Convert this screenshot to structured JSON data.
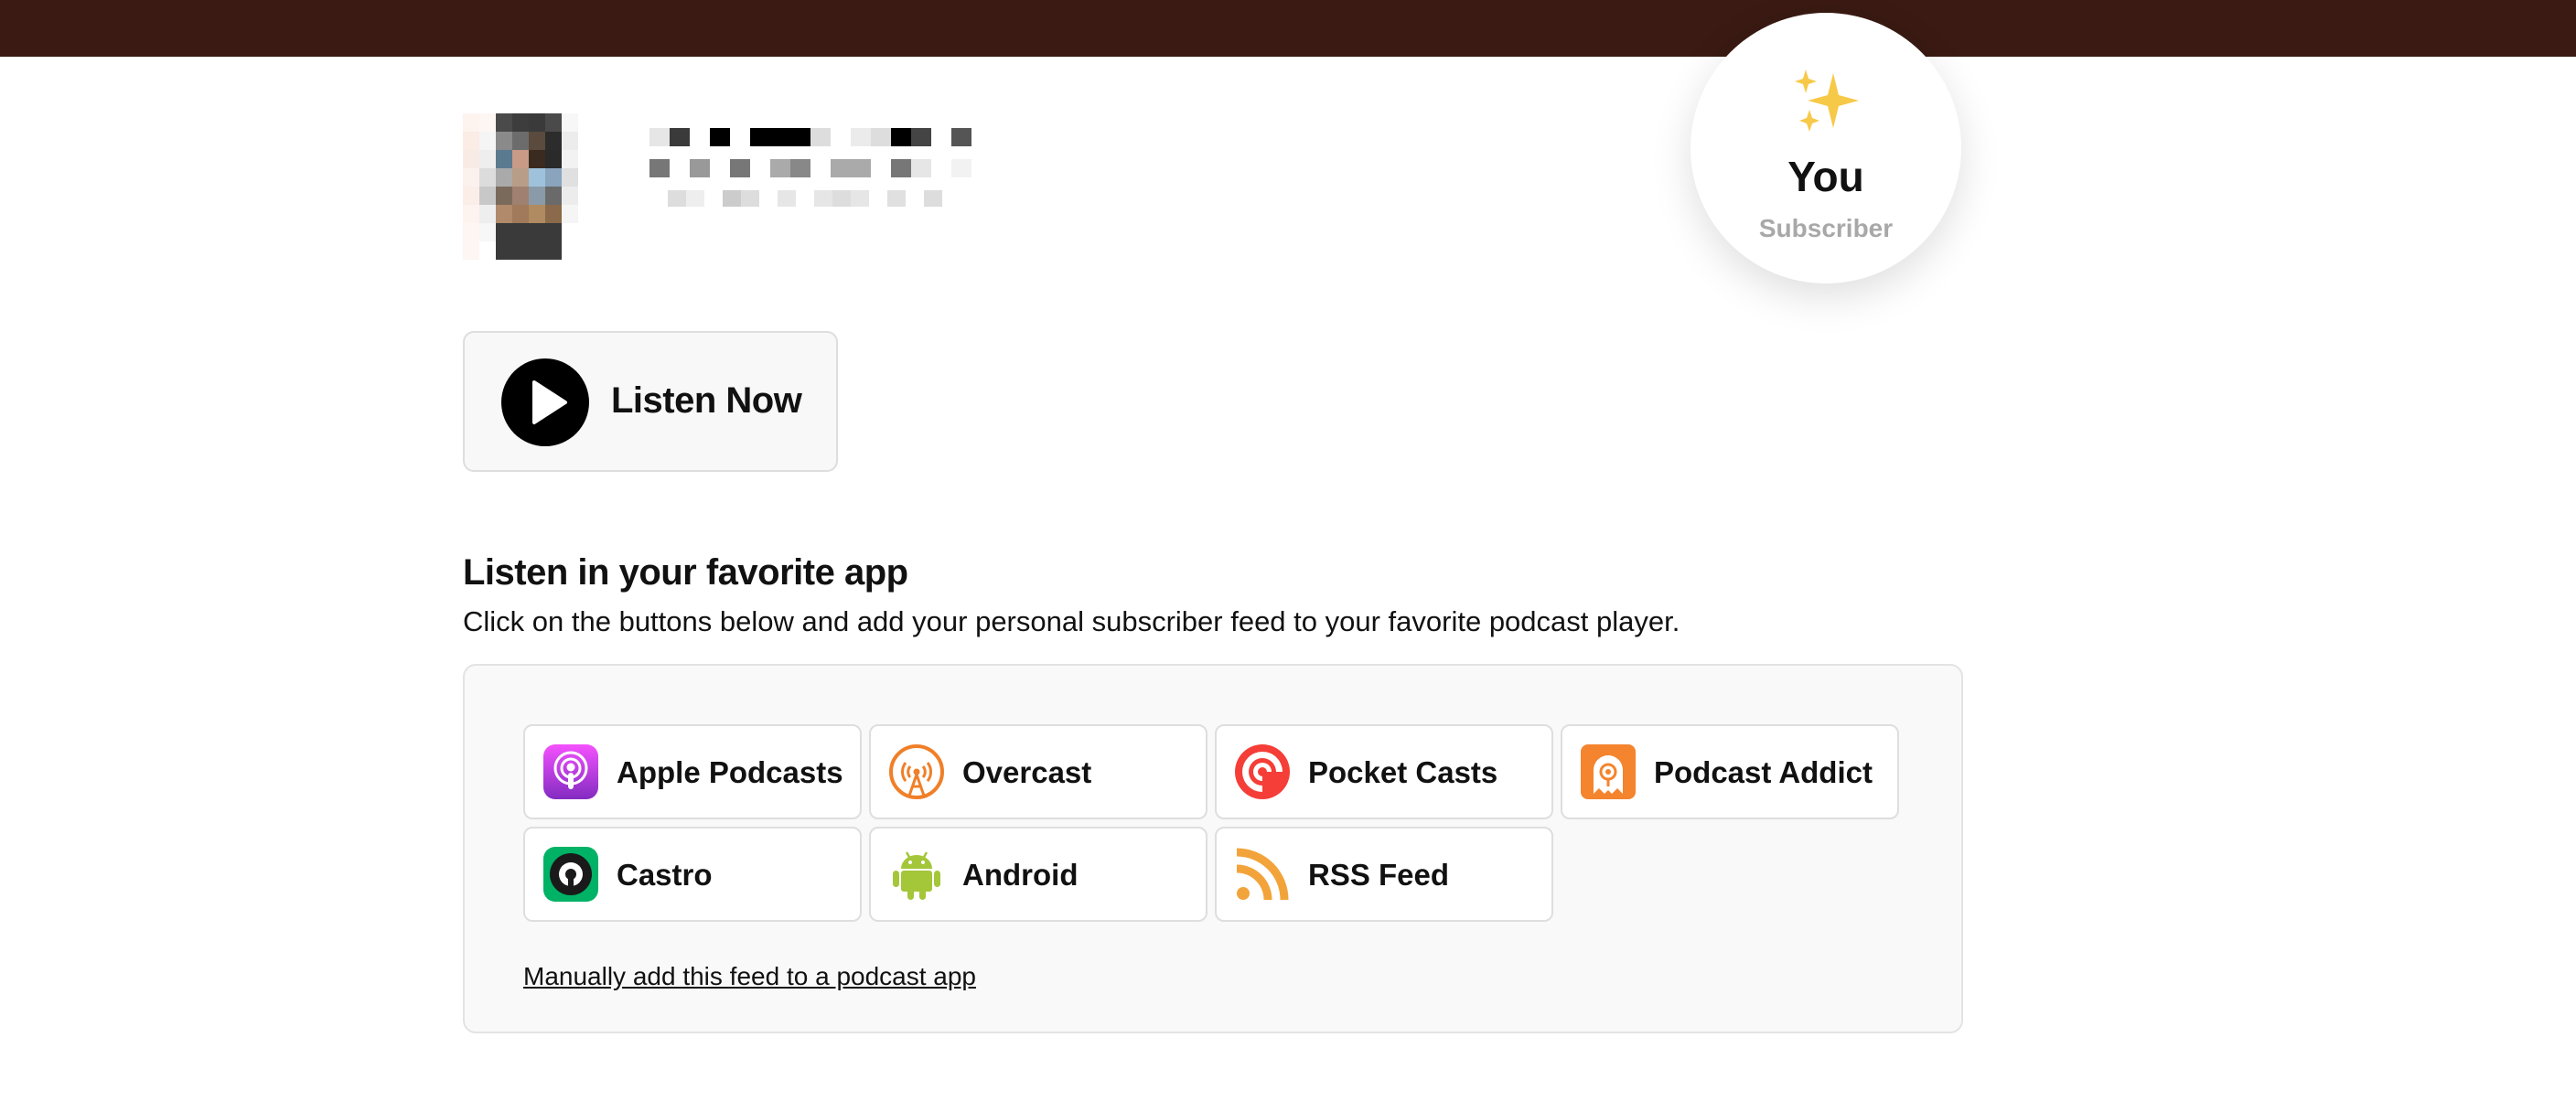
{
  "header": {
    "color": "#3a1a12"
  },
  "podcast": {
    "artwork_icon": "podcast-cover-pixelated",
    "title_icon": "pixelated-title-text"
  },
  "badge": {
    "icon": "sparkles-icon",
    "name": "You",
    "role": "Subscriber"
  },
  "listen_now": {
    "label": "Listen Now",
    "icon": "play-icon"
  },
  "apps_section": {
    "title": "Listen in your favorite app",
    "description": "Click on the buttons below and add your personal subscriber feed to your favorite podcast player.",
    "apps": [
      {
        "label": "Apple Podcasts",
        "icon": "apple-podcasts-icon",
        "color": "#a94fe0"
      },
      {
        "label": "Overcast",
        "icon": "overcast-icon",
        "color": "#f07f28"
      },
      {
        "label": "Pocket Casts",
        "icon": "pocket-casts-icon",
        "color": "#f43e37"
      },
      {
        "label": "Podcast Addict",
        "icon": "podcast-addict-icon",
        "color": "#f4842d"
      },
      {
        "label": "Castro",
        "icon": "castro-icon",
        "color": "#00b265"
      },
      {
        "label": "Android",
        "icon": "android-icon",
        "color": "#a4c639"
      },
      {
        "label": "RSS Feed",
        "icon": "rss-feed-icon",
        "color": "#f2a43a"
      }
    ],
    "manual_link": "Manually add this feed to a podcast app"
  }
}
